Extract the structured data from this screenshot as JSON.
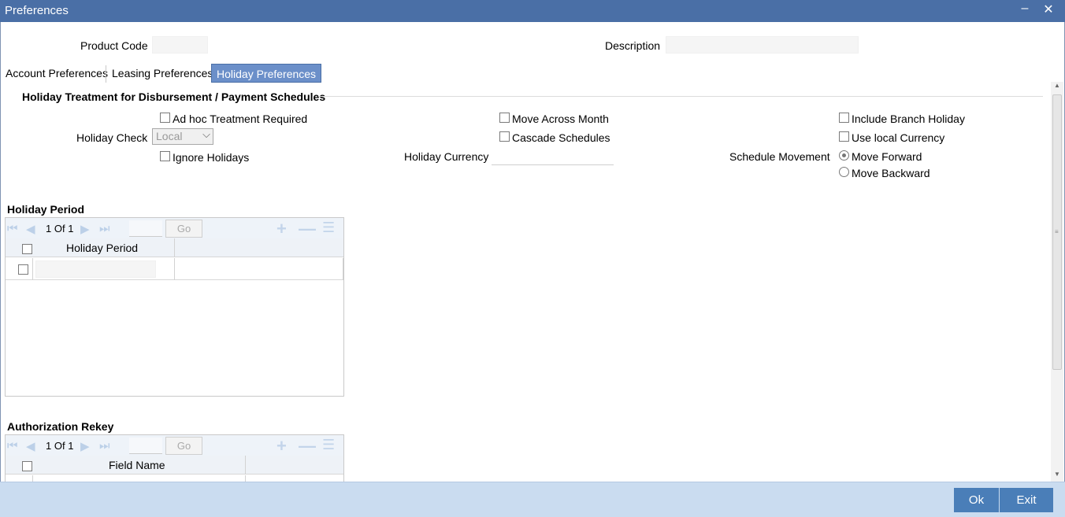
{
  "window": {
    "title": "Preferences"
  },
  "header": {
    "product_code_label": "Product Code",
    "product_code_value": "",
    "description_label": "Description",
    "description_value": ""
  },
  "tabs": [
    {
      "label": "Account Preferences",
      "active": false
    },
    {
      "label": "Leasing Preferences",
      "active": false
    },
    {
      "label": "Holiday Preferences",
      "active": true
    }
  ],
  "holiday_treatment": {
    "title": "Holiday Treatment for Disbursement / Payment Schedules",
    "adhoc_label": "Ad hoc Treatment Required",
    "adhoc_checked": false,
    "holiday_check_label": "Holiday Check",
    "holiday_check_value": "Local",
    "ignore_holidays_label": "Ignore Holidays",
    "ignore_holidays_checked": false,
    "move_across_month_label": "Move Across Month",
    "move_across_month_checked": false,
    "cascade_schedules_label": "Cascade Schedules",
    "cascade_schedules_checked": false,
    "holiday_currency_label": "Holiday Currency",
    "holiday_currency_value": "",
    "include_branch_holiday_label": "Include Branch Holiday",
    "include_branch_holiday_checked": false,
    "use_local_currency_label": "Use local Currency",
    "use_local_currency_checked": false,
    "schedule_movement_label": "Schedule Movement",
    "move_forward_label": "Move Forward",
    "move_backward_label": "Move Backward",
    "schedule_movement_selected": "Move Forward"
  },
  "holiday_period": {
    "title": "Holiday Period",
    "page_current": "1",
    "page_of": "Of",
    "page_total": "1",
    "go_label": "Go",
    "column_header": "Holiday Period",
    "rows": [
      {
        "holiday_period": ""
      }
    ]
  },
  "authorization_rekey": {
    "title": "Authorization Rekey",
    "page_current": "1",
    "page_of": "Of",
    "page_total": "1",
    "go_label": "Go",
    "column_header": "Field Name"
  },
  "footer": {
    "ok_label": "Ok",
    "exit_label": "Exit"
  },
  "colors": {
    "titlebar": "#4a6fa6",
    "active_tab": "#6b8fc9",
    "footer": "#cadcf0",
    "button": "#4a7eb8"
  }
}
